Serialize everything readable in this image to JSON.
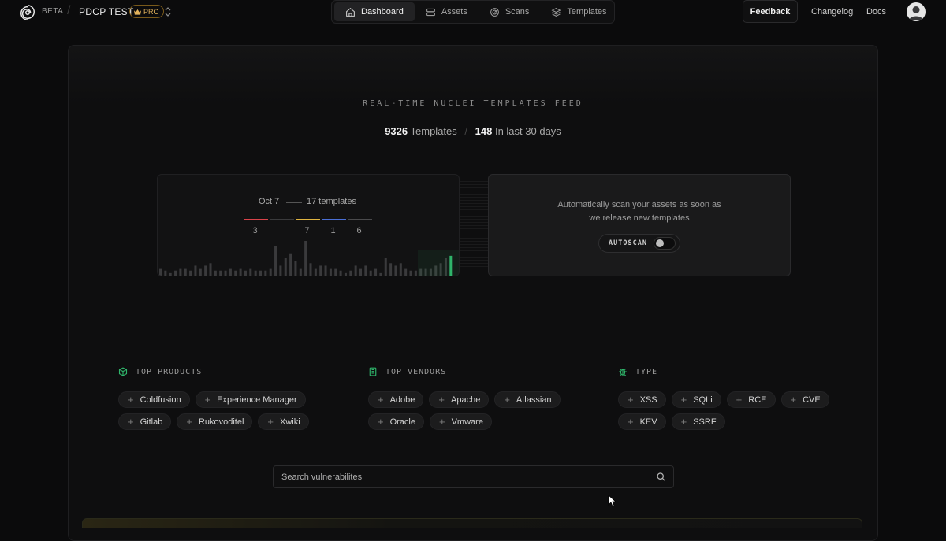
{
  "header": {
    "beta_label": "BETA",
    "project_name": "PDCP TEST",
    "plan_badge": "PRO",
    "nav_tabs": [
      {
        "label": "Dashboard",
        "icon": "home-icon",
        "active": true
      },
      {
        "label": "Assets",
        "icon": "server-icon",
        "active": false
      },
      {
        "label": "Scans",
        "icon": "radar-icon",
        "active": false
      },
      {
        "label": "Templates",
        "icon": "layers-icon",
        "active": false
      }
    ],
    "feedback_label": "Feedback",
    "changelog_label": "Changelog",
    "docs_label": "Docs"
  },
  "feed": {
    "title": "REAL-TIME NUCLEI TEMPLATES FEED",
    "total_count": "9326",
    "total_label": "Templates",
    "recent_count": "148",
    "recent_label": "In last 30 days"
  },
  "chart_data": {
    "type": "bar",
    "selected_date": "Oct 7",
    "selected_count_label": "17 templates",
    "breakdown": [
      {
        "value": "3",
        "color": "#d9434a"
      },
      {
        "value": "",
        "color": "#3a3a3c"
      },
      {
        "value": "7",
        "color": "#e0b441"
      },
      {
        "value": "1",
        "color": "#4a6fd6"
      },
      {
        "value": "6",
        "color": "#4a4a4c"
      }
    ],
    "values": [
      3,
      2,
      1,
      2,
      3,
      3,
      2,
      4,
      3,
      4,
      5,
      2,
      2,
      2,
      3,
      2,
      3,
      2,
      3,
      2,
      2,
      2,
      3,
      12,
      4,
      7,
      9,
      6,
      3,
      14,
      5,
      3,
      4,
      4,
      3,
      3,
      2,
      1,
      2,
      4,
      3,
      4,
      2,
      3,
      1,
      7,
      5,
      4,
      5,
      3,
      2,
      2,
      3,
      3,
      3,
      4,
      5,
      7,
      8
    ],
    "highlight_color": "#2fb56b",
    "bar_color": "#3a3a3c"
  },
  "autoscan": {
    "description": "Automatically scan your assets as soon as we release new templates",
    "label": "AUTOSCAN",
    "enabled": false
  },
  "sections": {
    "products": {
      "title": "TOP PRODUCTS",
      "items": [
        "Coldfusion",
        "Experience Manager",
        "Gitlab",
        "Rukovoditel",
        "Xwiki"
      ]
    },
    "vendors": {
      "title": "TOP VENDORS",
      "items": [
        "Adobe",
        "Apache",
        "Atlassian",
        "Oracle",
        "Vmware"
      ]
    },
    "types": {
      "title": "TYPE",
      "items": [
        "XSS",
        "SQLi",
        "RCE",
        "CVE",
        "KEV",
        "SSRF"
      ]
    }
  },
  "search": {
    "placeholder": "Search vulnerabilites"
  },
  "colors": {
    "accent_green": "#2fb56b",
    "pro_gold": "#e3b35c"
  }
}
